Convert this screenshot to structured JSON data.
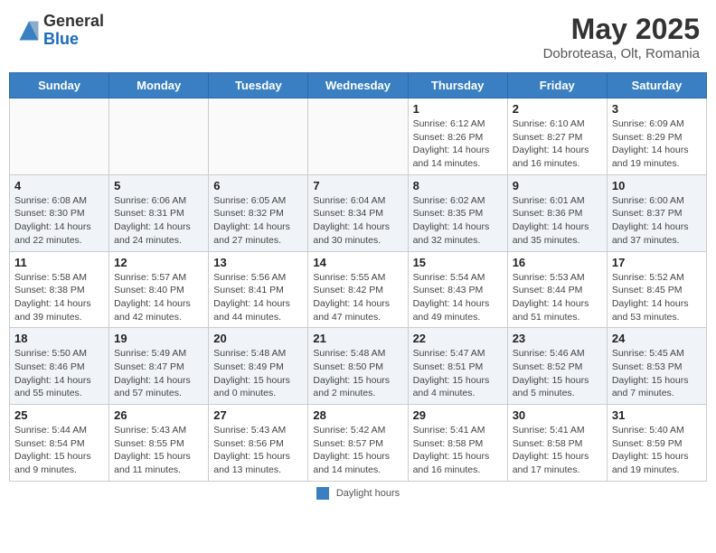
{
  "header": {
    "logo_general": "General",
    "logo_blue": "Blue",
    "month": "May 2025",
    "location": "Dobroteasa, Olt, Romania"
  },
  "weekdays": [
    "Sunday",
    "Monday",
    "Tuesday",
    "Wednesday",
    "Thursday",
    "Friday",
    "Saturday"
  ],
  "footer": {
    "label": "Daylight hours"
  },
  "weeks": [
    [
      {
        "day": "",
        "info": ""
      },
      {
        "day": "",
        "info": ""
      },
      {
        "day": "",
        "info": ""
      },
      {
        "day": "",
        "info": ""
      },
      {
        "day": "1",
        "info": "Sunrise: 6:12 AM\nSunset: 8:26 PM\nDaylight: 14 hours\nand 14 minutes."
      },
      {
        "day": "2",
        "info": "Sunrise: 6:10 AM\nSunset: 8:27 PM\nDaylight: 14 hours\nand 16 minutes."
      },
      {
        "day": "3",
        "info": "Sunrise: 6:09 AM\nSunset: 8:29 PM\nDaylight: 14 hours\nand 19 minutes."
      }
    ],
    [
      {
        "day": "4",
        "info": "Sunrise: 6:08 AM\nSunset: 8:30 PM\nDaylight: 14 hours\nand 22 minutes."
      },
      {
        "day": "5",
        "info": "Sunrise: 6:06 AM\nSunset: 8:31 PM\nDaylight: 14 hours\nand 24 minutes."
      },
      {
        "day": "6",
        "info": "Sunrise: 6:05 AM\nSunset: 8:32 PM\nDaylight: 14 hours\nand 27 minutes."
      },
      {
        "day": "7",
        "info": "Sunrise: 6:04 AM\nSunset: 8:34 PM\nDaylight: 14 hours\nand 30 minutes."
      },
      {
        "day": "8",
        "info": "Sunrise: 6:02 AM\nSunset: 8:35 PM\nDaylight: 14 hours\nand 32 minutes."
      },
      {
        "day": "9",
        "info": "Sunrise: 6:01 AM\nSunset: 8:36 PM\nDaylight: 14 hours\nand 35 minutes."
      },
      {
        "day": "10",
        "info": "Sunrise: 6:00 AM\nSunset: 8:37 PM\nDaylight: 14 hours\nand 37 minutes."
      }
    ],
    [
      {
        "day": "11",
        "info": "Sunrise: 5:58 AM\nSunset: 8:38 PM\nDaylight: 14 hours\nand 39 minutes."
      },
      {
        "day": "12",
        "info": "Sunrise: 5:57 AM\nSunset: 8:40 PM\nDaylight: 14 hours\nand 42 minutes."
      },
      {
        "day": "13",
        "info": "Sunrise: 5:56 AM\nSunset: 8:41 PM\nDaylight: 14 hours\nand 44 minutes."
      },
      {
        "day": "14",
        "info": "Sunrise: 5:55 AM\nSunset: 8:42 PM\nDaylight: 14 hours\nand 47 minutes."
      },
      {
        "day": "15",
        "info": "Sunrise: 5:54 AM\nSunset: 8:43 PM\nDaylight: 14 hours\nand 49 minutes."
      },
      {
        "day": "16",
        "info": "Sunrise: 5:53 AM\nSunset: 8:44 PM\nDaylight: 14 hours\nand 51 minutes."
      },
      {
        "day": "17",
        "info": "Sunrise: 5:52 AM\nSunset: 8:45 PM\nDaylight: 14 hours\nand 53 minutes."
      }
    ],
    [
      {
        "day": "18",
        "info": "Sunrise: 5:50 AM\nSunset: 8:46 PM\nDaylight: 14 hours\nand 55 minutes."
      },
      {
        "day": "19",
        "info": "Sunrise: 5:49 AM\nSunset: 8:47 PM\nDaylight: 14 hours\nand 57 minutes."
      },
      {
        "day": "20",
        "info": "Sunrise: 5:48 AM\nSunset: 8:49 PM\nDaylight: 15 hours\nand 0 minutes."
      },
      {
        "day": "21",
        "info": "Sunrise: 5:48 AM\nSunset: 8:50 PM\nDaylight: 15 hours\nand 2 minutes."
      },
      {
        "day": "22",
        "info": "Sunrise: 5:47 AM\nSunset: 8:51 PM\nDaylight: 15 hours\nand 4 minutes."
      },
      {
        "day": "23",
        "info": "Sunrise: 5:46 AM\nSunset: 8:52 PM\nDaylight: 15 hours\nand 5 minutes."
      },
      {
        "day": "24",
        "info": "Sunrise: 5:45 AM\nSunset: 8:53 PM\nDaylight: 15 hours\nand 7 minutes."
      }
    ],
    [
      {
        "day": "25",
        "info": "Sunrise: 5:44 AM\nSunset: 8:54 PM\nDaylight: 15 hours\nand 9 minutes."
      },
      {
        "day": "26",
        "info": "Sunrise: 5:43 AM\nSunset: 8:55 PM\nDaylight: 15 hours\nand 11 minutes."
      },
      {
        "day": "27",
        "info": "Sunrise: 5:43 AM\nSunset: 8:56 PM\nDaylight: 15 hours\nand 13 minutes."
      },
      {
        "day": "28",
        "info": "Sunrise: 5:42 AM\nSunset: 8:57 PM\nDaylight: 15 hours\nand 14 minutes."
      },
      {
        "day": "29",
        "info": "Sunrise: 5:41 AM\nSunset: 8:58 PM\nDaylight: 15 hours\nand 16 minutes."
      },
      {
        "day": "30",
        "info": "Sunrise: 5:41 AM\nSunset: 8:58 PM\nDaylight: 15 hours\nand 17 minutes."
      },
      {
        "day": "31",
        "info": "Sunrise: 5:40 AM\nSunset: 8:59 PM\nDaylight: 15 hours\nand 19 minutes."
      }
    ]
  ]
}
